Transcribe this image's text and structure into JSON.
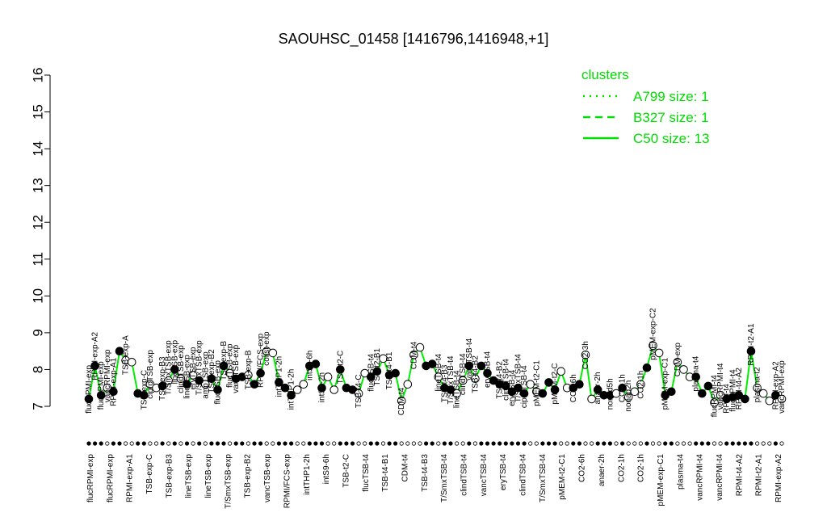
{
  "chart_data": {
    "type": "line",
    "title": "SAOUHSC_01458 [1416796,1416948,+1]",
    "xlabel": "",
    "ylabel": "",
    "ylim": [
      7,
      16
    ],
    "y_ticks": [
      "7",
      "8",
      "9",
      "10",
      "11",
      "12",
      "13",
      "14",
      "15",
      "16"
    ],
    "grid": false,
    "legend": {
      "placement": "top-right",
      "title": "clusters",
      "color": "#00dd00",
      "entries": [
        {
          "label": "A799 size: 1",
          "style": "dotted"
        },
        {
          "label": "B327 size: 1",
          "style": "dashed"
        },
        {
          "label": "C50 size: 13",
          "style": "solid"
        }
      ]
    },
    "line_color": "#00ee00",
    "points": [
      {
        "label": "flucRPMI-exp",
        "y": 7.2,
        "filled": true
      },
      {
        "label": "RPMI-exp-A2",
        "y": 8.1,
        "filled": true
      },
      {
        "label": "flucRPMI-exp",
        "y": 7.3,
        "filled": true
      },
      {
        "label": "vancRPMI-exp",
        "y": 7.5,
        "filled": false
      },
      {
        "label": "RPMI-exp-A1",
        "y": 7.4,
        "filled": true
      },
      {
        "label": "",
        "y": 8.5,
        "filled": true
      },
      {
        "label": "TSB-exp-A",
        "y": 8.25,
        "filled": false
      },
      {
        "label": "",
        "y": 8.2,
        "filled": false
      },
      {
        "label": "",
        "y": 7.35,
        "filled": true
      },
      {
        "label": "TSB-exp-C",
        "y": 7.3,
        "filled": true
      },
      {
        "label": "ciproTSB-exp",
        "y": 7.6,
        "filled": false
      },
      {
        "label": "",
        "y": 7.5,
        "filled": false
      },
      {
        "label": "TSB-exp-B3",
        "y": 7.55,
        "filled": true
      },
      {
        "label": "T/SmxTSB-exp",
        "y": 7.7,
        "filled": false
      },
      {
        "label": "lineTSB-exp",
        "y": 8.0,
        "filled": true
      },
      {
        "label": "clindTSB-exp",
        "y": 7.75,
        "filled": false
      },
      {
        "label": "lineTSB-exp",
        "y": 7.6,
        "filled": true
      },
      {
        "label": "eryTSB-exp",
        "y": 7.85,
        "filled": false
      },
      {
        "label": "T/SmxTSB-exp",
        "y": 7.7,
        "filled": true
      },
      {
        "label": "ampTSB-exp",
        "y": 7.6,
        "filled": false
      },
      {
        "label": "TSB-exp-B2",
        "y": 7.75,
        "filled": true
      },
      {
        "label": "flucTSB-exp",
        "y": 7.45,
        "filled": true
      },
      {
        "label": "TSB-exp-B",
        "y": 8.1,
        "filled": true
      },
      {
        "label": "flucTSB-exp",
        "y": 7.9,
        "filled": false
      },
      {
        "label": "vancTSB-exp",
        "y": 7.75,
        "filled": true
      },
      {
        "label": "",
        "y": 7.8,
        "filled": true
      },
      {
        "label": "TSB-exp-B",
        "y": 7.85,
        "filled": false
      },
      {
        "label": "",
        "y": 7.6,
        "filled": true
      },
      {
        "label": "RPMI/FCS-exp",
        "y": 7.9,
        "filled": true
      },
      {
        "label": "colist-exp",
        "y": 8.5,
        "filled": false
      },
      {
        "label": "",
        "y": 8.45,
        "filled": false
      },
      {
        "label": "intTHP1-2h",
        "y": 7.65,
        "filled": true
      },
      {
        "label": "",
        "y": 7.5,
        "filled": true
      },
      {
        "label": "intTHP1-2h",
        "y": 7.3,
        "filled": true
      },
      {
        "label": "",
        "y": 7.45,
        "filled": false
      },
      {
        "label": "",
        "y": 7.6,
        "filled": false
      },
      {
        "label": "intS9-6h",
        "y": 8.1,
        "filled": true
      },
      {
        "label": "",
        "y": 8.15,
        "filled": true
      },
      {
        "label": "intS9-2h",
        "y": 7.5,
        "filled": true
      },
      {
        "label": "",
        "y": 7.8,
        "filled": false
      },
      {
        "label": "",
        "y": 7.45,
        "filled": false
      },
      {
        "label": "TSB-t2-C",
        "y": 8.0,
        "filled": true
      },
      {
        "label": "",
        "y": 7.5,
        "filled": true
      },
      {
        "label": "",
        "y": 7.45,
        "filled": true
      },
      {
        "label": "TSB-t4-C",
        "y": 7.35,
        "filled": false
      },
      {
        "label": "",
        "y": 7.9,
        "filled": false
      },
      {
        "label": "flucTSB-t4",
        "y": 7.8,
        "filled": true
      },
      {
        "label": "TSB-t2-B1",
        "y": 7.95,
        "filled": true
      },
      {
        "label": "",
        "y": 8.3,
        "filled": false
      },
      {
        "label": "TSB-t4-B1",
        "y": 7.85,
        "filled": true
      },
      {
        "label": "",
        "y": 7.9,
        "filled": true
      },
      {
        "label": "CDM-t4",
        "y": 7.15,
        "filled": false
      },
      {
        "label": "",
        "y": 7.6,
        "filled": false
      },
      {
        "label": "CDM-t4",
        "y": 8.4,
        "filled": false
      },
      {
        "label": "",
        "y": 8.6,
        "filled": false
      },
      {
        "label": "",
        "y": 8.1,
        "filled": true
      },
      {
        "label": "",
        "y": 8.15,
        "filled": true
      },
      {
        "label": "lineTSB-t4",
        "y": 7.8,
        "filled": false
      },
      {
        "label": "TSB-t4-B3",
        "y": 7.5,
        "filled": true
      },
      {
        "label": "T/SmxTSB-t4",
        "y": 7.45,
        "filled": true
      },
      {
        "label": "lineTSB-t4",
        "y": 7.35,
        "filled": false
      },
      {
        "label": "clindTSB-t4",
        "y": 7.7,
        "filled": false
      },
      {
        "label": "vancTSB-t4",
        "y": 8.1,
        "filled": true
      },
      {
        "label": "TSB-t4-B2",
        "y": 7.75,
        "filled": false
      },
      {
        "label": "",
        "y": 8.1,
        "filled": true
      },
      {
        "label": "eryTSB-t4",
        "y": 7.9,
        "filled": true
      },
      {
        "label": "",
        "y": 7.7,
        "filled": true
      },
      {
        "label": "TSB-t4-B2",
        "y": 7.6,
        "filled": true
      },
      {
        "label": "clindTSB-t4",
        "y": 7.55,
        "filled": true
      },
      {
        "label": "eryTSB-t4",
        "y": 7.4,
        "filled": true
      },
      {
        "label": "T/SmxTSB-t4",
        "y": 7.5,
        "filled": true
      },
      {
        "label": "ciproTSB-t4",
        "y": 7.35,
        "filled": true
      },
      {
        "label": "",
        "y": 7.6,
        "filled": false
      },
      {
        "label": "pMEM-t2-C1",
        "y": 7.4,
        "filled": false
      },
      {
        "label": "",
        "y": 7.35,
        "filled": true
      },
      {
        "label": "",
        "y": 7.65,
        "filled": true
      },
      {
        "label": "pMEM-t2-C",
        "y": 7.45,
        "filled": true
      },
      {
        "label": "",
        "y": 7.95,
        "filled": false
      },
      {
        "label": "",
        "y": 7.5,
        "filled": false
      },
      {
        "label": "CO2-6h",
        "y": 7.5,
        "filled": true
      },
      {
        "label": "",
        "y": 7.6,
        "filled": true
      },
      {
        "label": "CO2-3h",
        "y": 8.4,
        "filled": false
      },
      {
        "label": "",
        "y": 7.2,
        "filled": false
      },
      {
        "label": "anaer-2h",
        "y": 7.45,
        "filled": true
      },
      {
        "label": "",
        "y": 7.3,
        "filled": true
      },
      {
        "label": "nonad5h",
        "y": 7.3,
        "filled": true
      },
      {
        "label": "",
        "y": 7.35,
        "filled": false
      },
      {
        "label": "CO2-1h",
        "y": 7.5,
        "filled": true
      },
      {
        "label": "nonad2h",
        "y": 7.25,
        "filled": false
      },
      {
        "label": "",
        "y": 7.4,
        "filled": false
      },
      {
        "label": "CO2-1h",
        "y": 7.6,
        "filled": false
      },
      {
        "label": "",
        "y": 8.05,
        "filled": true
      },
      {
        "label": "pMEM-exp-C2",
        "y": 8.65,
        "filled": false
      },
      {
        "label": "",
        "y": 8.45,
        "filled": false
      },
      {
        "label": "pMEM-exp-C1",
        "y": 7.3,
        "filled": true
      },
      {
        "label": "",
        "y": 7.4,
        "filled": true
      },
      {
        "label": "CDM-exp",
        "y": 8.2,
        "filled": false
      },
      {
        "label": "",
        "y": 8.0,
        "filled": false
      },
      {
        "label": "",
        "y": 7.8,
        "filled": false
      },
      {
        "label": "plasma-t4",
        "y": 7.8,
        "filled": true
      },
      {
        "label": "",
        "y": 7.35,
        "filled": true
      },
      {
        "label": "",
        "y": 7.55,
        "filled": true
      },
      {
        "label": "flucRPMI-t4",
        "y": 7.1,
        "filled": false
      },
      {
        "label": "vancRPMI-t4",
        "y": 7.3,
        "filled": false
      },
      {
        "label": "RPMI-t4",
        "y": 7.2,
        "filled": true
      },
      {
        "label": "flucRPMI-t4",
        "y": 7.25,
        "filled": true
      },
      {
        "label": "RPMI-t4-A2",
        "y": 7.3,
        "filled": true
      },
      {
        "label": "",
        "y": 7.2,
        "filled": true
      },
      {
        "label": "RPMI-t2-A1",
        "y": 8.5,
        "filled": true
      },
      {
        "label": "plasma-t2",
        "y": 7.5,
        "filled": false
      },
      {
        "label": "",
        "y": 7.35,
        "filled": false
      },
      {
        "label": "",
        "y": 7.15,
        "filled": false
      },
      {
        "label": "RPMI-exp-A2",
        "y": 7.3,
        "filled": true
      },
      {
        "label": "vancRPMI-exp",
        "y": 7.2,
        "filled": false
      }
    ],
    "x_tick_labels": [
      "flucRPMI-exp",
      "flucRPMI-exp",
      "RPMI-exp-A1",
      "TSB-exp-C",
      "TSB-exp-B3",
      "lineTSB-exp",
      "lineTSB-exp",
      "T/SmxTSB-exp",
      "TSB-exp-B2",
      "vancTSB-exp",
      "RPMI/FCS-exp",
      "intTHP1-2h",
      "intS9-6h",
      "TSB-t2-C",
      "flucTSB-t4",
      "TSB-t4-B1",
      "CDM-t4",
      "TSB-t4-B3",
      "T/SmxTSB-t4",
      "clindTSB-t4",
      "vancTSB-t4",
      "eryTSB-t4",
      "clindTSB-t4",
      "T/SmxTSB-t4",
      "pMEM-t2-C1",
      "CO2-6h",
      "anaer-2h",
      "CO2-1h",
      "CO2-1h",
      "pMEM-exp-C1",
      "plasma-t4",
      "vancRPMI-t4",
      "vancRPMI-t4",
      "RPMI-t4-A2",
      "RPMI-t2-A1",
      "RPMI-exp-A2"
    ]
  }
}
